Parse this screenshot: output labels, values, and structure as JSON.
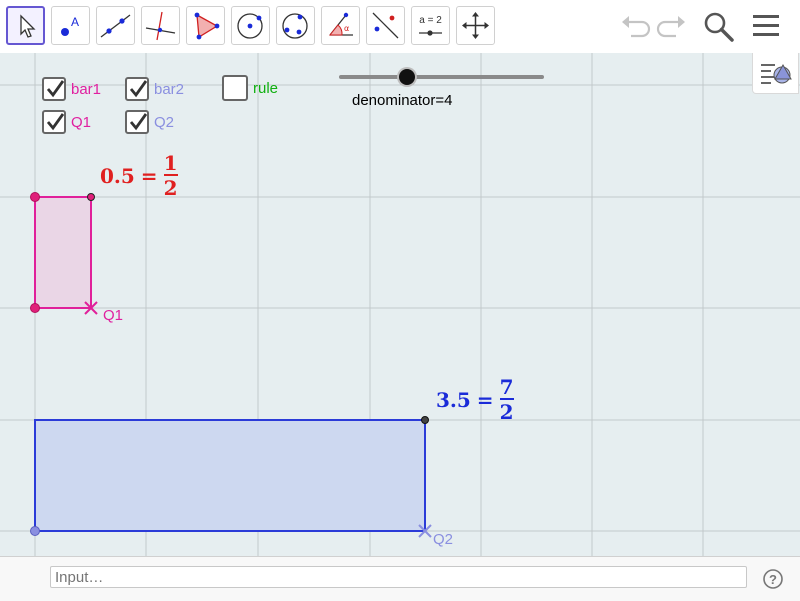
{
  "toolbar": {
    "tools": [
      {
        "name": "move-tool",
        "icon": "arrow-cursor-icon",
        "selected": true
      },
      {
        "name": "point-tool",
        "icon": "point-icon"
      },
      {
        "name": "line-tool",
        "icon": "line-through-points-icon"
      },
      {
        "name": "perpendicular-tool",
        "icon": "perpendicular-line-icon"
      },
      {
        "name": "polygon-tool",
        "icon": "polygon-icon"
      },
      {
        "name": "circle-tool",
        "icon": "circle-center-point-icon"
      },
      {
        "name": "conic-tool",
        "icon": "circle-three-points-icon"
      },
      {
        "name": "angle-tool",
        "icon": "angle-icon"
      },
      {
        "name": "reflect-tool",
        "icon": "reflect-icon"
      },
      {
        "name": "slider-tool",
        "icon": "slider-icon",
        "text": "a = 2"
      },
      {
        "name": "move-view-tool",
        "icon": "move-view-icon"
      }
    ],
    "undo_icon": "undo-icon",
    "redo_icon": "redo-icon",
    "search_icon": "search-icon",
    "menu_icon": "hamburger-menu-icon"
  },
  "graphics": {
    "background": "#e6eef0",
    "style_bar_icon": "style-bar-toggle-icon",
    "checkboxes": [
      {
        "label": "bar1",
        "checked": true,
        "color": "#e020a0"
      },
      {
        "label": "bar2",
        "checked": true,
        "color": "#8a8fe0"
      },
      {
        "label": "rule",
        "checked": false,
        "color": "#10b010"
      },
      {
        "label": "Q1",
        "checked": true,
        "color": "#e020a0"
      },
      {
        "label": "Q2",
        "checked": true,
        "color": "#8a8fe0"
      }
    ],
    "slider": {
      "caption": "denominator=4",
      "value": 4
    },
    "label1": {
      "decimal": "0.5",
      "equals": "=",
      "numerator": "1",
      "denominator": "2",
      "color": "#e02020"
    },
    "label2": {
      "decimal": "3.5",
      "equals": "=",
      "numerator": "7",
      "denominator": "2",
      "color": "#1a2bd8"
    },
    "point_labels": {
      "q1": "Q1",
      "q2": "Q2"
    },
    "colors": {
      "bar1_stroke": "#e0209a",
      "bar1_fill": "#ead6e6",
      "bar2_stroke": "#2b3bd8",
      "bar2_fill": "#cdd8f0"
    }
  },
  "inputbar": {
    "placeholder": "Input…",
    "help_icon": "help-icon"
  }
}
